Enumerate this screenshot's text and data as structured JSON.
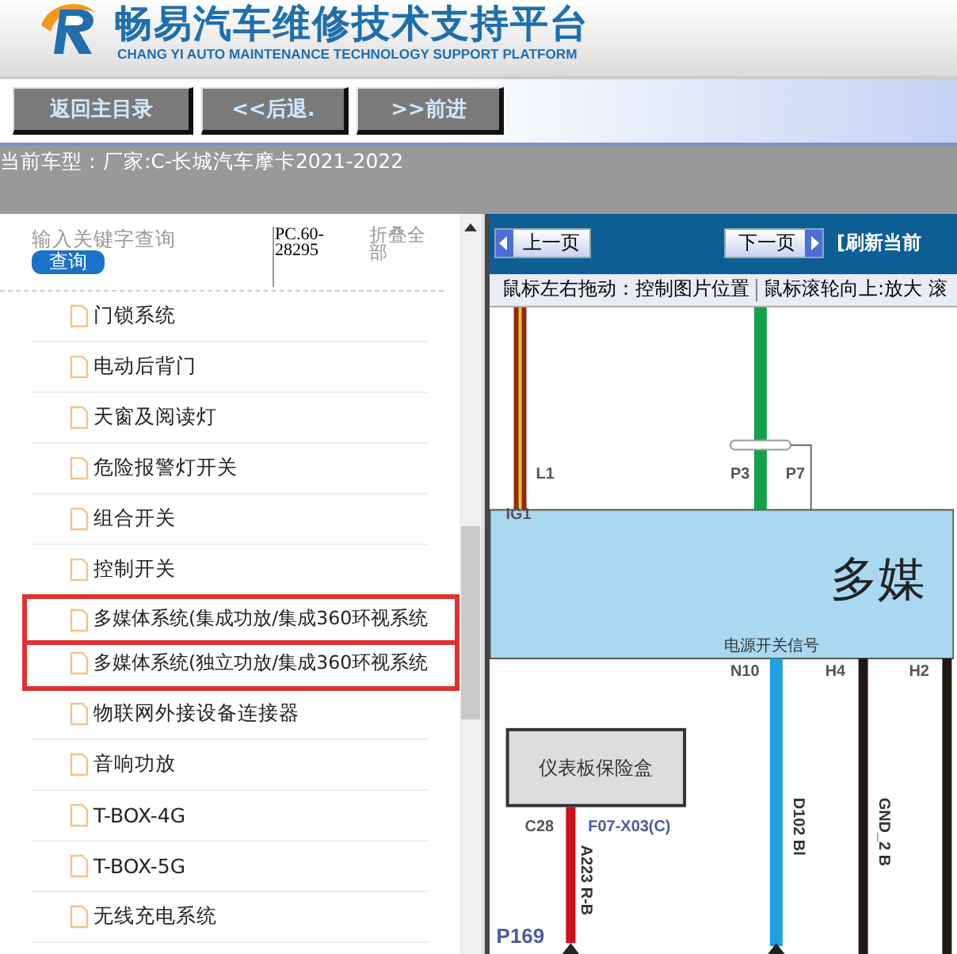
{
  "header": {
    "title": "畅易汽车维修技术支持平台",
    "subtitle": "CHANG YI AUTO MAINTENANCE TECHNOLOGY SUPPORT PLATFORM"
  },
  "toolbar": {
    "buttons": [
      "返回主目录",
      "<<后退.",
      ">>前进"
    ]
  },
  "car_model": {
    "label": "当前车型：",
    "value": "厂家:C-长城汽车摩卡2021-2022"
  },
  "sidebar": {
    "search": {
      "placeholder": "输入关键字查询",
      "button": "查询"
    },
    "code": "PC.60-28295",
    "collapse_all": "折叠全部",
    "items": [
      {
        "label": "门锁系统",
        "highlighted": false
      },
      {
        "label": "电动后背门",
        "highlighted": false
      },
      {
        "label": "天窗及阅读灯",
        "highlighted": false
      },
      {
        "label": "危险报警灯开关",
        "highlighted": false
      },
      {
        "label": "组合开关",
        "highlighted": false
      },
      {
        "label": "控制开关",
        "highlighted": false
      },
      {
        "label": "多媒体系统(集成功放/集成360环视系统",
        "highlighted": true
      },
      {
        "label": "多媒体系统(独立功放/集成360环视系统",
        "highlighted": true
      },
      {
        "label": "物联网外接设备连接器",
        "highlighted": false
      },
      {
        "label": "音响功放",
        "highlighted": false
      },
      {
        "label": "T-BOX-4G",
        "highlighted": false
      },
      {
        "label": "T-BOX-5G",
        "highlighted": false
      },
      {
        "label": "无线充电系统",
        "highlighted": false
      }
    ]
  },
  "viewer": {
    "prev_button": "上一页",
    "next_button": "下一页",
    "refresh": "[刷新当前",
    "hints": [
      "鼠标左右拖动：控制图片位置",
      "鼠标滚轮向上:放大",
      "滚"
    ],
    "diagram": {
      "module_title": "多媒",
      "signal_label": "电源开关信号",
      "fuse_box": "仪表板保险盒",
      "pins": [
        "L1",
        "P3",
        "P7",
        "IG1",
        "N10",
        "H4",
        "H2",
        "C28",
        "F07-X03(C)",
        "P169"
      ],
      "wires": [
        "A223 R-B",
        "D102 Bl",
        "GND_2 B"
      ]
    }
  }
}
